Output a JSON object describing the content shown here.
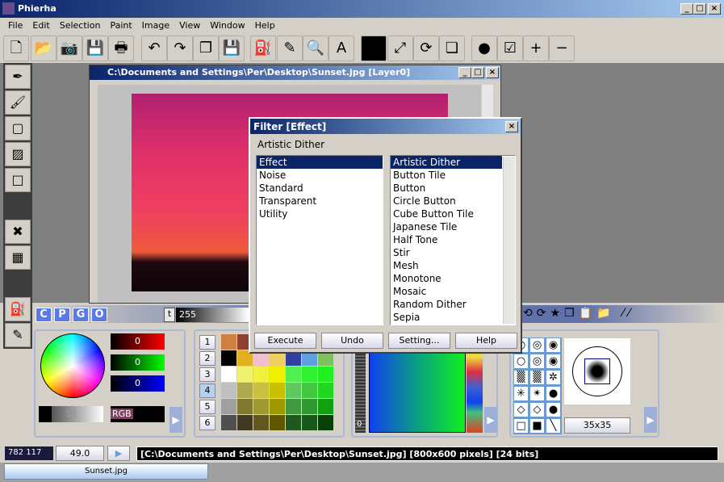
{
  "app": {
    "title": "Phierha",
    "controls": [
      "_",
      "□",
      "×"
    ]
  },
  "menu": [
    "File",
    "Edit",
    "Selection",
    "Paint",
    "Image",
    "View",
    "Window",
    "Help"
  ],
  "toolbar": [
    {
      "icon": "new-icon",
      "glyph": "🗋"
    },
    {
      "icon": "open-icon",
      "glyph": "📂"
    },
    {
      "icon": "camera-icon",
      "glyph": "📷"
    },
    {
      "icon": "save-icon",
      "glyph": "💾"
    },
    {
      "icon": "print-icon",
      "glyph": "🖶"
    },
    {
      "icon": "undo-icon",
      "glyph": "↶"
    },
    {
      "icon": "redo-icon",
      "glyph": "↷"
    },
    {
      "icon": "copy-icon",
      "glyph": "❐"
    },
    {
      "icon": "save-as-icon",
      "glyph": "💾"
    },
    {
      "icon": "paint-bucket-icon",
      "glyph": "⛽"
    },
    {
      "icon": "paint-pen-icon",
      "glyph": "✎"
    },
    {
      "icon": "zoom-icon",
      "glyph": "🔍"
    },
    {
      "icon": "text-icon",
      "glyph": "A"
    },
    {
      "icon": "color-swatch-icon",
      "glyph": ""
    },
    {
      "icon": "resize-icon",
      "glyph": "⤢"
    },
    {
      "icon": "rotate-icon",
      "glyph": "⟳"
    },
    {
      "icon": "layer-icon",
      "glyph": "❏"
    },
    {
      "icon": "sphere-icon",
      "glyph": "●"
    },
    {
      "icon": "checklist-icon",
      "glyph": "☑"
    },
    {
      "icon": "zoom-in-icon",
      "glyph": "+"
    },
    {
      "icon": "zoom-out-icon",
      "glyph": "−"
    }
  ],
  "left_tools": [
    {
      "icon": "pen-icon",
      "glyph": "✒"
    },
    {
      "icon": "brush-icon",
      "glyph": "🖌"
    },
    {
      "icon": "rectangle-select-icon",
      "glyph": "▢"
    },
    {
      "icon": "gradient-icon",
      "glyph": "▨"
    },
    {
      "icon": "rectangle-icon",
      "glyph": "□"
    },
    {
      "icon": "delete-selection-icon",
      "glyph": "✖"
    },
    {
      "icon": "transparency-icon",
      "glyph": "▦"
    },
    {
      "icon": "fill-icon",
      "glyph": "⛽"
    },
    {
      "icon": "paint-icon",
      "glyph": "✎"
    }
  ],
  "image_window": {
    "title": "C:\\Documents and Settings\\Per\\Desktop\\Sunset.jpg [Layer0]"
  },
  "filter_dialog": {
    "title": "Filter [Effect]",
    "current": "Artistic Dither",
    "categories": [
      "Effect",
      "Noise",
      "Standard",
      "Transparent",
      "Utility"
    ],
    "selected_category": "Effect",
    "filters": [
      "Artistic Dither",
      "Button Tile",
      "Button",
      "Circle Button",
      "Cube Button Tile",
      "Japanese Tile",
      "Half Tone",
      "Stir",
      "Mesh",
      "Monotone",
      "Mosaic",
      "Random Dither",
      "Sepia"
    ],
    "selected_filter": "Artistic Dither",
    "buttons": [
      "Execute",
      "Undo",
      "Setting...",
      "Help"
    ]
  },
  "bottom": {
    "mode_tabs": [
      "C",
      "P",
      "G",
      "O"
    ],
    "opacity_label": "t",
    "opacity": "255",
    "rgb": {
      "r": "0",
      "g": "0",
      "b": "0"
    },
    "gray": "58",
    "rgb_label": "RGB",
    "palette_pages": [
      "1",
      "2",
      "3",
      "4",
      "5",
      "6"
    ],
    "selected_page": "4",
    "gradient_value": "0",
    "brush_size": "35x35",
    "colors": {
      "accent": "#0a246a",
      "panel_border": "#a8b8d8"
    }
  },
  "status": {
    "coords": "782 117",
    "zoom": "49.0",
    "info": "[C:\\Documents and Settings\\Per\\Desktop\\Sunset.jpg] [800x600 pixels] [24 bits]"
  },
  "taskbar": {
    "doc": "Sunset.jpg"
  }
}
